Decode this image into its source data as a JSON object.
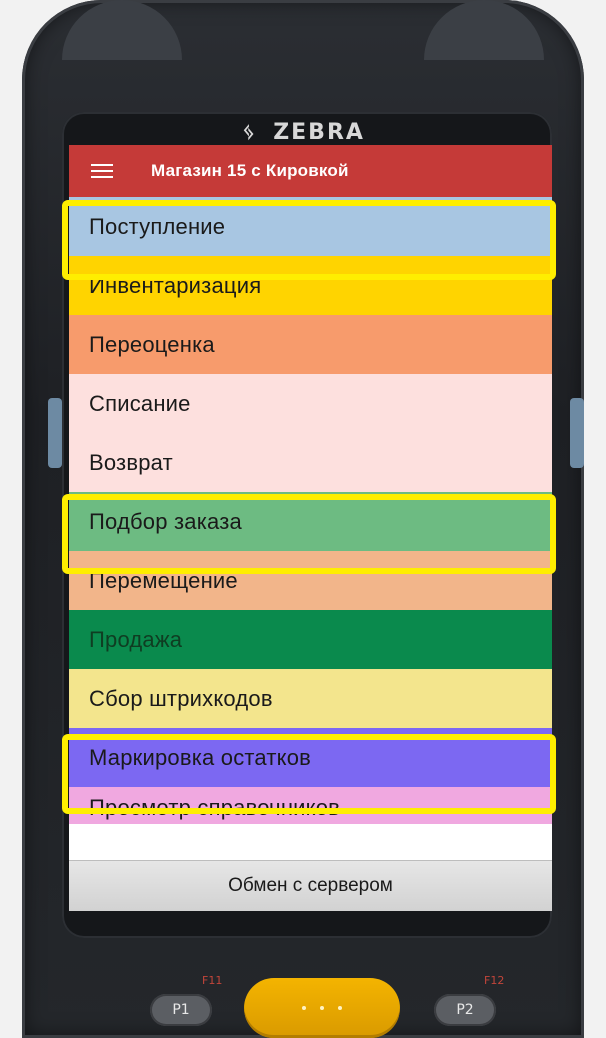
{
  "device": {
    "brand": "ZEBRA",
    "keys": {
      "f11": "F11",
      "f12": "F12",
      "p1": "P1",
      "p2": "P2"
    }
  },
  "appbar": {
    "title": "Магазин 15 с Кировкой",
    "menu_icon": "hamburger-menu-icon",
    "color": "#c53a38"
  },
  "menu": {
    "items": [
      {
        "label": "Поступление",
        "color": "#a8c6e2",
        "highlighted": true
      },
      {
        "label": "Инвентаризация",
        "color": "#ffd400",
        "highlighted": false
      },
      {
        "label": "Переоценка",
        "color": "#f79b6c",
        "highlighted": false
      },
      {
        "label": "Списание",
        "color": "#fde0de",
        "highlighted": false
      },
      {
        "label": "Возврат",
        "color": "#fde0de",
        "highlighted": false
      },
      {
        "label": "Подбор заказа",
        "color": "#6dbb82",
        "highlighted": true
      },
      {
        "label": "Перемещение",
        "color": "#f2b58a",
        "highlighted": false
      },
      {
        "label": "Продажа",
        "color": "#0a8a4d",
        "highlighted": false
      },
      {
        "label": "Сбор штрихкодов",
        "color": "#f3e58d",
        "highlighted": false
      },
      {
        "label": "Маркировка остатков",
        "color": "#7c68f2",
        "highlighted": true
      },
      {
        "label": "Просмотр справочников",
        "color": "#f0a8e0",
        "highlighted": false
      }
    ]
  },
  "footer": {
    "button_label": "Обмен с сервером"
  },
  "highlight_color": "#ffee00"
}
